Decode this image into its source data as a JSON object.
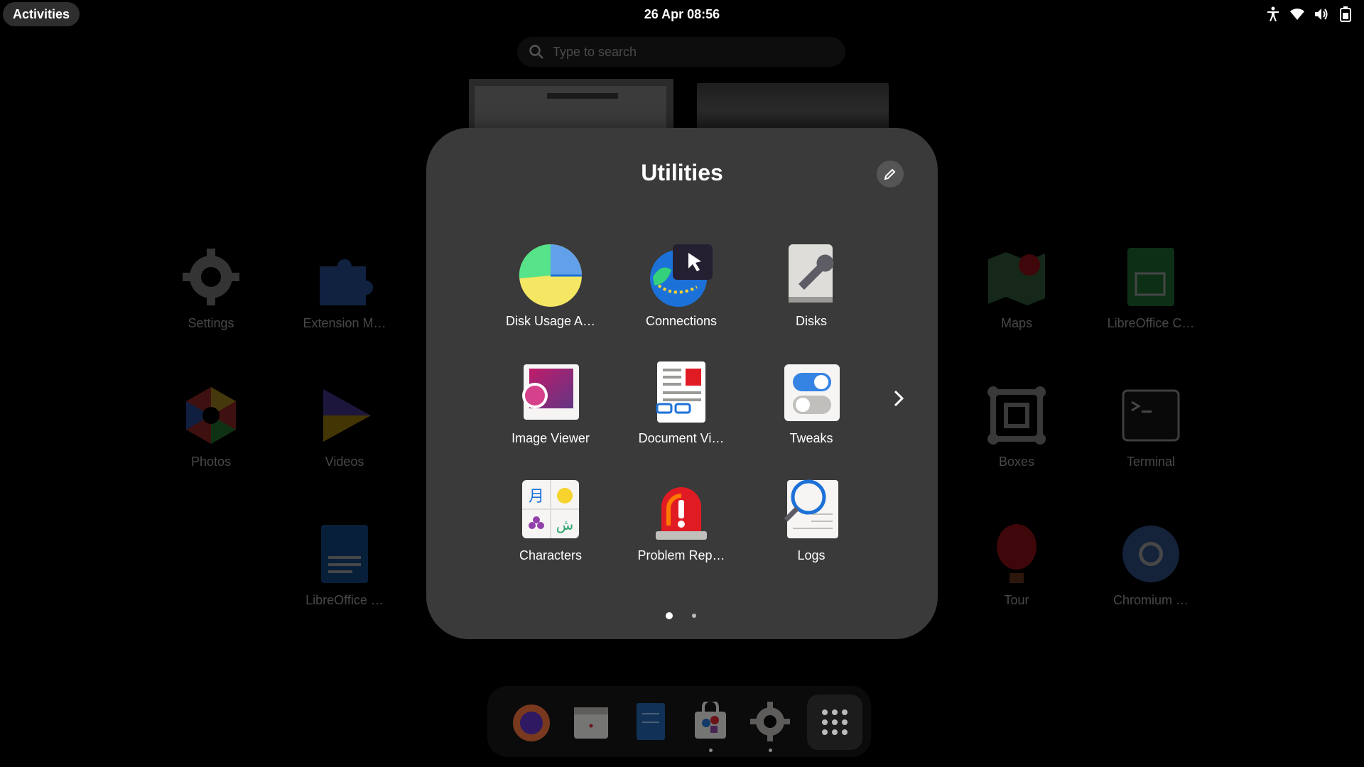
{
  "topbar": {
    "activities": "Activities",
    "clock": "26 Apr  08:56"
  },
  "search": {
    "placeholder": "Type to search"
  },
  "background_apps": [
    {
      "label": "Settings",
      "icon": "gear-icon"
    },
    {
      "label": "Extension M…",
      "icon": "puzzle-icon"
    },
    {
      "label": "Photos",
      "icon": "photos-icon"
    },
    {
      "label": "Videos",
      "icon": "videos-icon"
    },
    {
      "label": "LibreOffice …",
      "icon": "writer-icon"
    },
    {
      "label": "Maps",
      "icon": "maps-icon"
    },
    {
      "label": "LibreOffice C…",
      "icon": "calc-icon"
    },
    {
      "label": "Boxes",
      "icon": "boxes-icon"
    },
    {
      "label": "Terminal",
      "icon": "terminal-icon"
    },
    {
      "label": "Tour",
      "icon": "balloon-icon"
    },
    {
      "label": "Chromium …",
      "icon": "chromium-icon"
    }
  ],
  "folder": {
    "title": "Utilities",
    "apps": [
      {
        "label": "Disk Usage A…",
        "icon": "disk-usage-icon"
      },
      {
        "label": "Connections",
        "icon": "connections-icon"
      },
      {
        "label": "Disks",
        "icon": "disks-icon"
      },
      {
        "label": "Image Viewer",
        "icon": "image-viewer-icon"
      },
      {
        "label": "Document Vi…",
        "icon": "document-viewer-icon"
      },
      {
        "label": "Tweaks",
        "icon": "tweaks-icon"
      },
      {
        "label": "Characters",
        "icon": "characters-icon"
      },
      {
        "label": "Problem Rep…",
        "icon": "alarm-icon"
      },
      {
        "label": "Logs",
        "icon": "logs-icon"
      }
    ],
    "page_count": 2,
    "current_page": 1
  },
  "dash": {
    "items": [
      "firefox-icon",
      "calendar-icon",
      "text-editor-icon",
      "software-icon",
      "settings-icon",
      "app-grid-icon"
    ]
  },
  "colors": {
    "folder_bg": "#3a3a3a",
    "accent_blue": "#3584e4"
  }
}
